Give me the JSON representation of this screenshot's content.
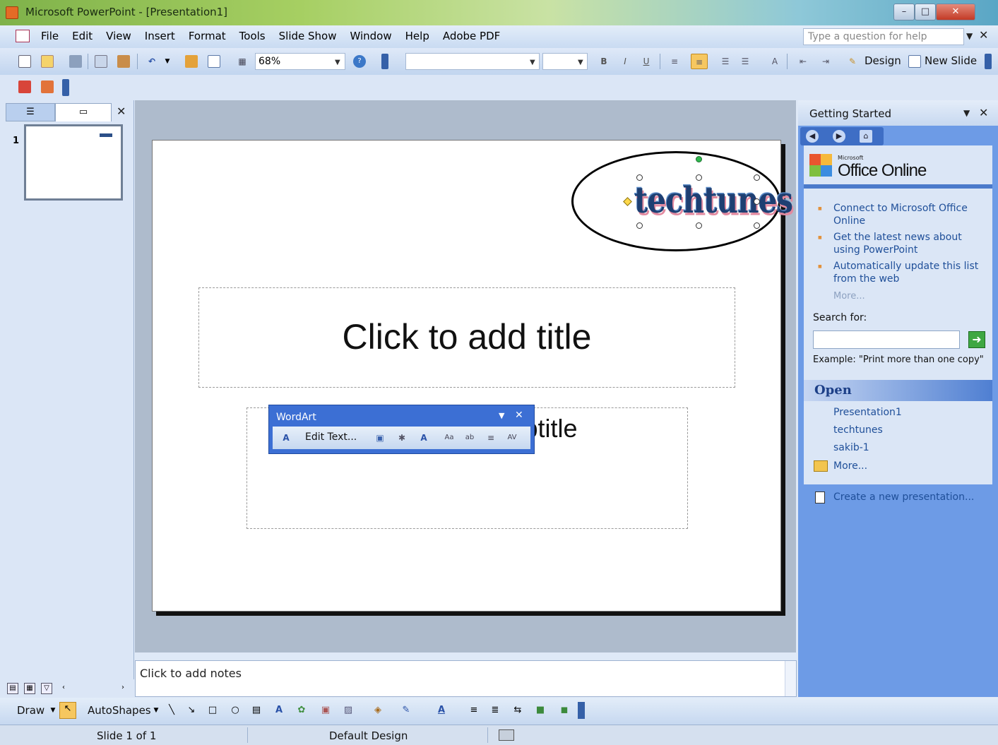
{
  "window": {
    "title": "Microsoft PowerPoint - [Presentation1]"
  },
  "menubar": {
    "items": [
      "File",
      "Edit",
      "View",
      "Insert",
      "Format",
      "Tools",
      "Slide Show",
      "Window",
      "Help",
      "Adobe PDF"
    ],
    "help_placeholder": "Type a question for help"
  },
  "toolbar": {
    "zoom": "68%",
    "design_label": "Design",
    "new_slide_label": "New Slide",
    "bold": "B",
    "italic": "I",
    "underline": "U"
  },
  "left_pane": {
    "slide_number": "1"
  },
  "slide": {
    "wordart_text": "techtunes",
    "title_placeholder": "Click to add title",
    "subtitle_placeholder": "Click to add subtitle"
  },
  "wordart_toolbar": {
    "title": "WordArt",
    "edit_text_label": "Edit Text..."
  },
  "notes": {
    "placeholder": "Click to add notes"
  },
  "task_pane": {
    "title": "Getting Started",
    "office_small": "Microsoft",
    "office_brand": "Office Online",
    "links": [
      "Connect to Microsoft Office Online",
      "Get the latest news about using PowerPoint",
      "Automatically update this list from the web"
    ],
    "more_label": "More...",
    "search_label": "Search for:",
    "example": "Example:  \"Print more than one copy\"",
    "open_heading": "Open",
    "files": [
      "Presentation1",
      "techtunes",
      "sakib-1"
    ],
    "open_more": "More...",
    "create_new": "Create a new presentation..."
  },
  "drawing_toolbar": {
    "draw_label": "Draw",
    "autoshapes_label": "AutoShapes"
  },
  "status_bar": {
    "slide_info": "Slide 1 of 1",
    "design": "Default Design"
  }
}
